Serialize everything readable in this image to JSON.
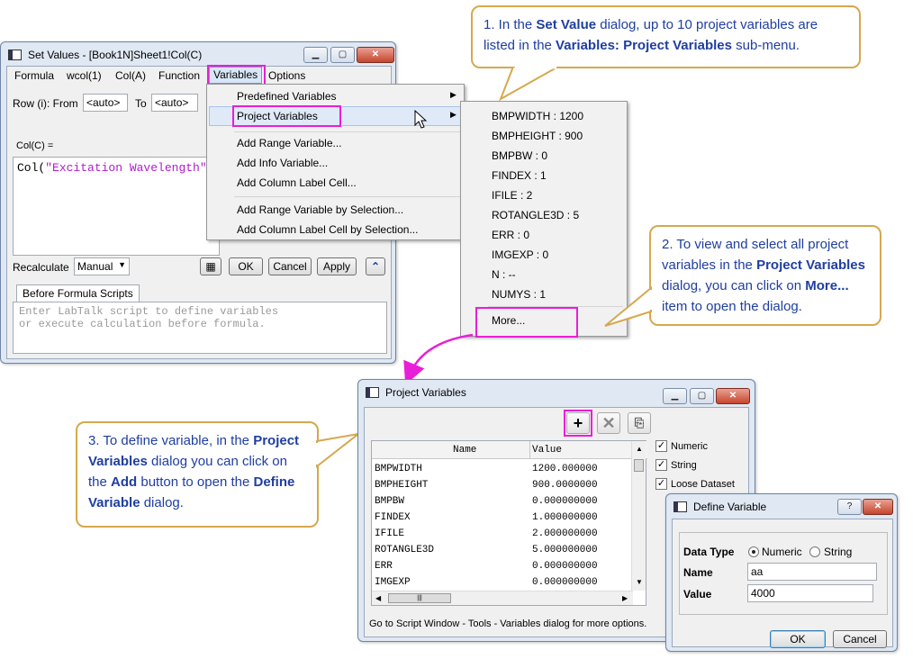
{
  "callouts": {
    "c1": {
      "p1": "1. In the ",
      "b1": "Set Value",
      "p2": " dialog, up to 10 project variables are listed in the ",
      "b2": "Variables: Project Variables",
      "p3": " sub-menu."
    },
    "c2": {
      "p1": "2. To view and select all project variables in the ",
      "b1": "Project Variables",
      "p2": " dialog,  you can click on ",
      "b2": "More...",
      "p3": " item to open the dialog."
    },
    "c3": {
      "p1": "3. To define variable, in the ",
      "b1": "Project Variables",
      "p2": " dialog you can click on the ",
      "b2": "Add",
      "p3": " button to open the ",
      "b3": "Define Variable",
      "p4": " dialog."
    }
  },
  "set_values": {
    "title": "Set Values - [Book1N]Sheet1!Col(C)",
    "menu": [
      "Formula",
      "wcol(1)",
      "Col(A)",
      "Function",
      "Variables",
      "Options"
    ],
    "row_label": "Row (i):  From",
    "from_value": "<auto>",
    "to_label": "To",
    "to_value": "<auto>",
    "col_label": "Col(C) =",
    "formula_text": "Col(\"Excitation Wavelength\"",
    "recalculate_label": "Recalculate",
    "recalculate_value": "Manual",
    "ok": "OK",
    "cancel": "Cancel",
    "apply": "Apply",
    "before_tab": "Before Formula Scripts",
    "before_placeholder": "Enter LabTalk script to define variables\nor execute calculation before formula."
  },
  "variables_menu": {
    "items": [
      "Predefined Variables",
      "Project Variables",
      "Add Range Variable...",
      "Add Info Variable...",
      "Add Column Label Cell...",
      "Add Range Variable by Selection...",
      "Add Column Label Cell by Selection..."
    ]
  },
  "project_submenu": {
    "items": [
      "BMPWIDTH : 1200",
      "BMPHEIGHT : 900",
      "BMPBW : 0",
      "FINDEX : 1",
      "IFILE : 2",
      "ROTANGLE3D : 5",
      "ERR : 0",
      "IMGEXP : 0",
      "N : --",
      "NUMYS : 1"
    ],
    "more": "More..."
  },
  "project_vars_dialog": {
    "title": "Project Variables",
    "col_name": "Name",
    "col_value": "Value",
    "rows": [
      {
        "name": "BMPWIDTH",
        "value": "1200.000000"
      },
      {
        "name": "BMPHEIGHT",
        "value": "900.0000000"
      },
      {
        "name": "BMPBW",
        "value": "0.000000000"
      },
      {
        "name": "FINDEX",
        "value": "1.000000000"
      },
      {
        "name": "IFILE",
        "value": "2.000000000"
      },
      {
        "name": "ROTANGLE3D",
        "value": "5.000000000"
      },
      {
        "name": "ERR",
        "value": "0.000000000"
      },
      {
        "name": "IMGEXP",
        "value": "0.000000000"
      }
    ],
    "checks": [
      "Numeric",
      "String",
      "Loose Dataset"
    ],
    "status": "Go to Script Window - Tools - Variables dialog for more options."
  },
  "define_var_dialog": {
    "title": "Define Variable",
    "data_type_label": "Data Type",
    "opt_numeric": "Numeric",
    "opt_string": "String",
    "name_label": "Name",
    "name_value": "aa",
    "value_label": "Value",
    "value_value": "4000",
    "ok": "OK",
    "cancel": "Cancel",
    "help": "?"
  },
  "colors": {
    "highlight": "#e91ed8",
    "callout_text": "#1f3ea0",
    "callout_border": "#d6a84e"
  }
}
